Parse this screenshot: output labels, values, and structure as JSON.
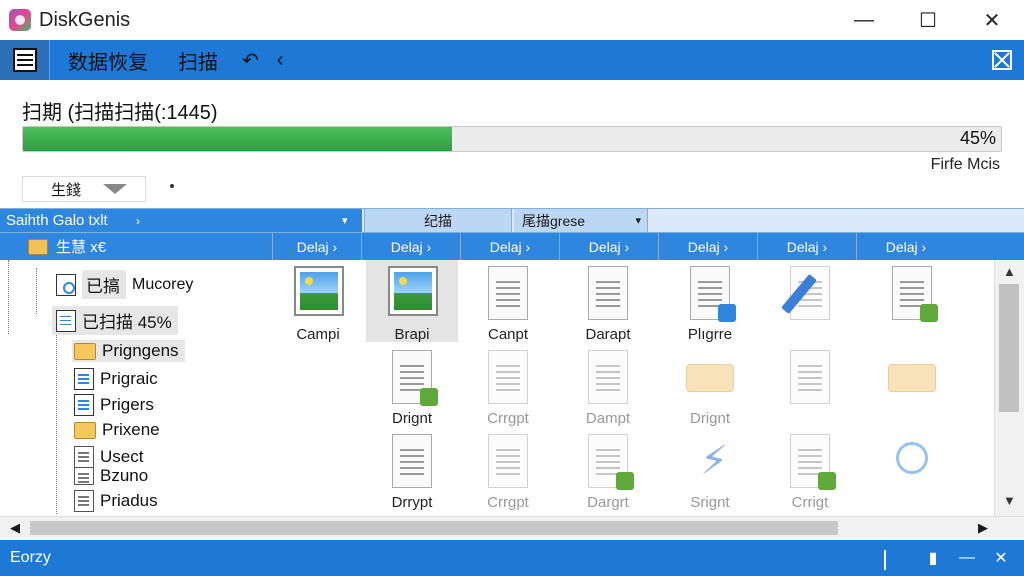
{
  "window": {
    "title": "DiskGenis",
    "minimize": "—",
    "maximize": "☐",
    "close": "✕"
  },
  "toolbar": {
    "recover_label": "数据恢复",
    "scan_label": "扫描",
    "undo_glyph": "↶",
    "back_glyph": "‹"
  },
  "scan": {
    "title": "扫期 (扫描扫描(:1445)",
    "progress_percent": 45,
    "progress_label": "45%",
    "file_mode": "Firfe Mcis",
    "sort_label": "生錢"
  },
  "filter_bar": {
    "path": "Saihth Galo txlt",
    "caret": "›",
    "col_scan": "纪描",
    "col_type": "尾描grese"
  },
  "header": {
    "tree_label": "生慧 x€",
    "columns": [
      "Delaj ›",
      "Delaj ›",
      "Delaj ›",
      "Delaj ›",
      "Delaj ›",
      "Delaj ›",
      "Delaj ›"
    ]
  },
  "tree": {
    "nodes": [
      {
        "label": "已搞",
        "sub": "Mucorey"
      },
      {
        "label": "已扫描 45%"
      },
      {
        "label": "Prigngens"
      },
      {
        "label": "Prigraic"
      },
      {
        "label": "Prigers"
      },
      {
        "label": "Prixene"
      },
      {
        "label": "Usect"
      },
      {
        "label": "Bzuno"
      },
      {
        "label": "Priadus"
      }
    ]
  },
  "files": {
    "row1": [
      "Campi",
      "Brapi",
      "Canpt",
      "Darapt",
      "Plıgrre",
      "",
      ""
    ],
    "row2": [
      "Drignt",
      "Crrgpt",
      "Dampt",
      "Drignt",
      "",
      ""
    ],
    "row3": [
      "Drrypt",
      "Crrgpt",
      "Dargrt",
      "Srignt",
      "Crrigt",
      ""
    ]
  },
  "status": {
    "text": "Eorzy"
  },
  "icons": {
    "app": "diskgenius-logo-icon",
    "toolbar_home": "document-list-icon",
    "close_panel": "close-icon",
    "image": "image-file-icon",
    "doc": "document-icon"
  },
  "colors": {
    "accent": "#1e78d6",
    "progress": "#2ea043"
  }
}
